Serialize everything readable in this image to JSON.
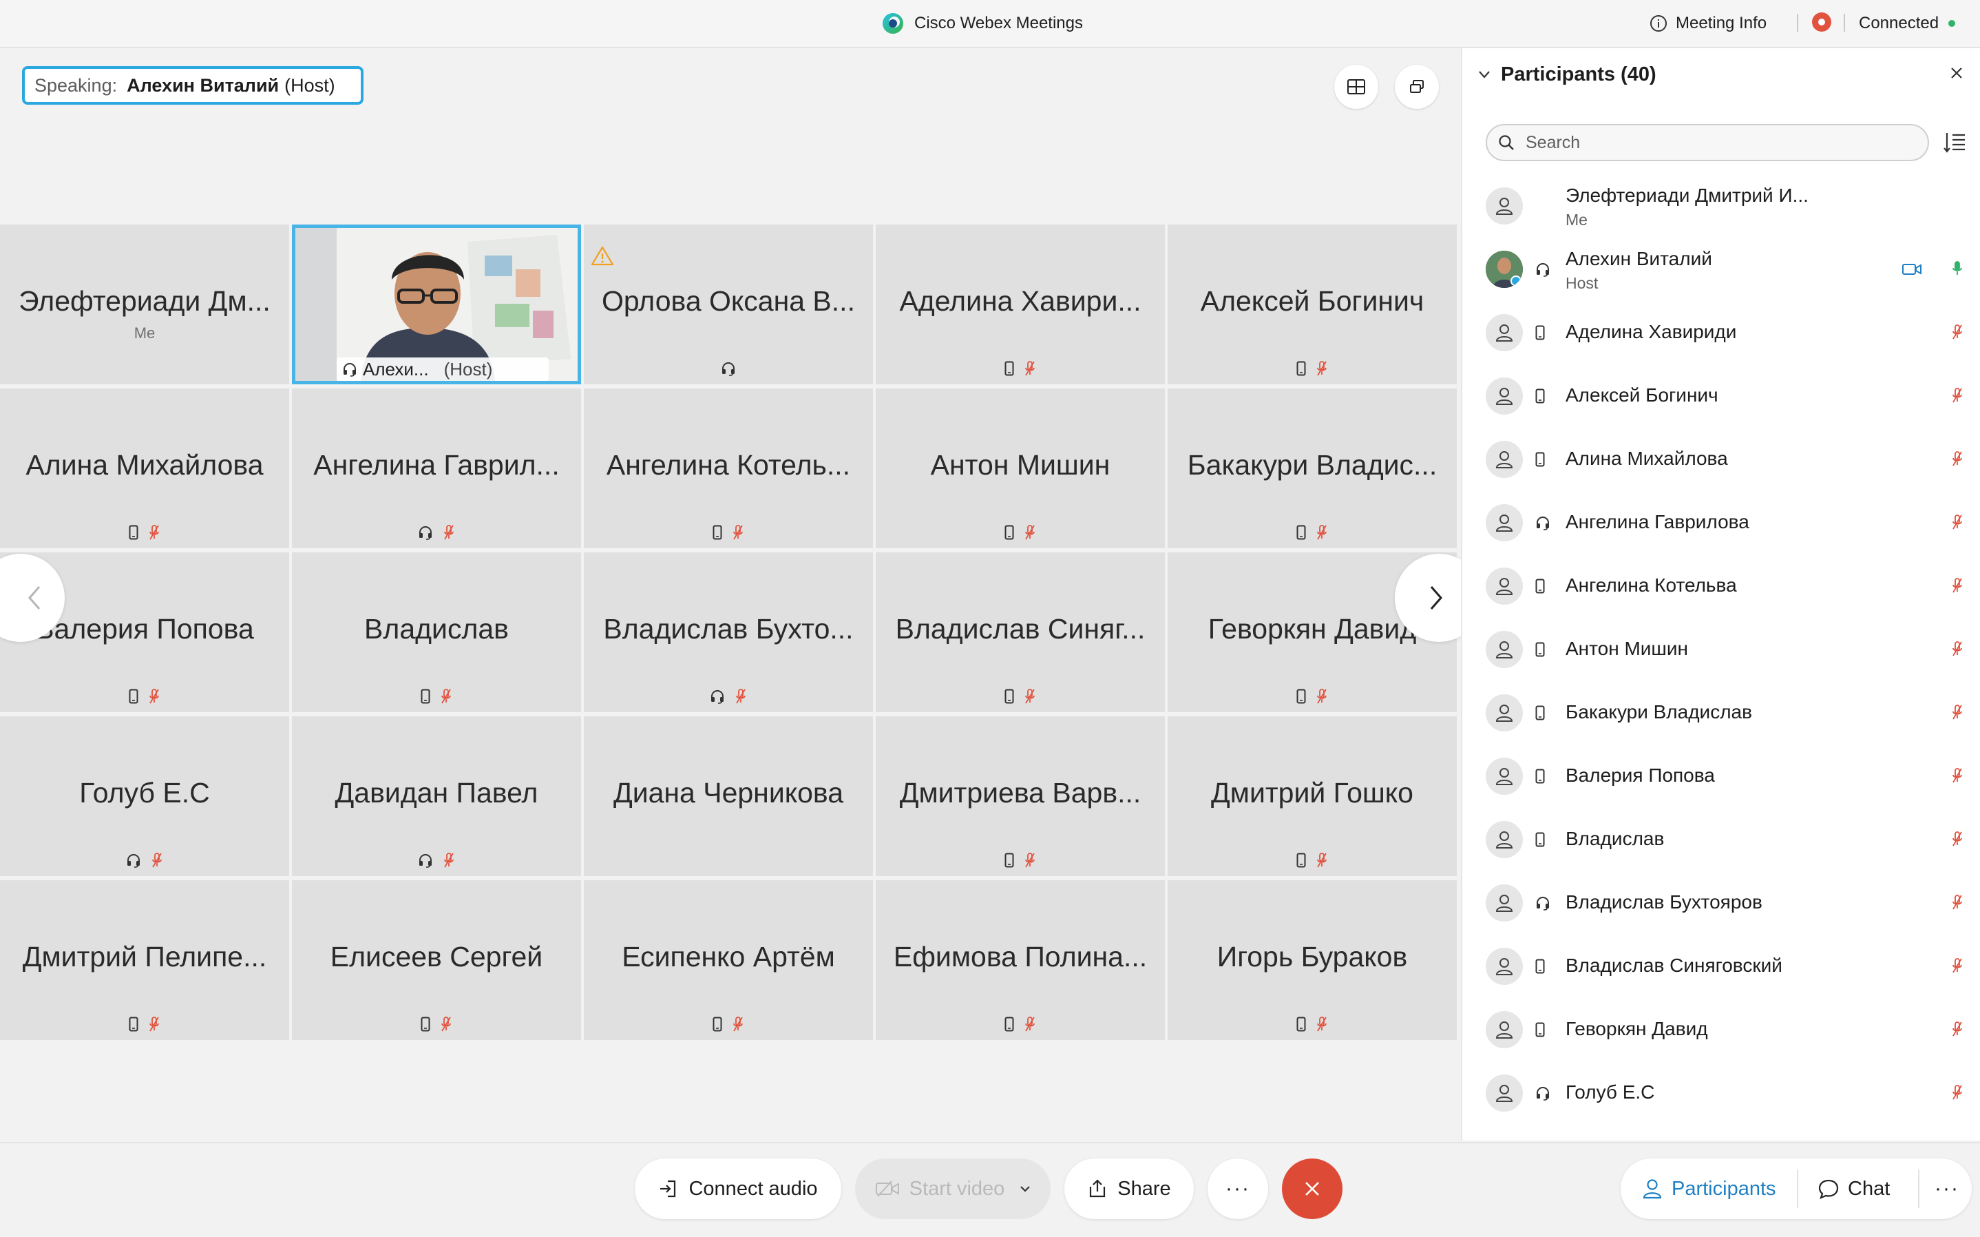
{
  "titlebar": {
    "app_title": "Cisco Webex Meetings",
    "meeting_info": "Meeting Info",
    "connection_status": "Connected"
  },
  "stage": {
    "speaking_label": "Speaking:",
    "speaking_name": "Алехин Виталий",
    "speaking_role": "(Host)",
    "tiles": [
      {
        "name": "Элефтериади Дм...",
        "sub": "Me",
        "icons": []
      },
      {
        "name": "Алехи...",
        "sub": "(Host)",
        "video": true,
        "icons": []
      },
      {
        "name": "Орлова Оксана В...",
        "warn": true,
        "icons": [
          "headset-icon"
        ]
      },
      {
        "name": "Аделина Хавири...",
        "icons": [
          "phone-icon",
          "mic-muted-icon"
        ]
      },
      {
        "name": "Алексей Богинич",
        "icons": [
          "phone-icon",
          "mic-muted-icon"
        ]
      },
      {
        "name": "Алина Михайлова",
        "icons": [
          "phone-icon",
          "mic-muted-icon"
        ]
      },
      {
        "name": "Ангелина Гаврил...",
        "icons": [
          "headset-icon",
          "mic-muted-icon"
        ]
      },
      {
        "name": "Ангелина Котель...",
        "icons": [
          "phone-icon",
          "mic-muted-icon"
        ]
      },
      {
        "name": "Антон Мишин",
        "icons": [
          "phone-icon",
          "mic-muted-icon"
        ]
      },
      {
        "name": "Бакакури Владис...",
        "icons": [
          "phone-icon",
          "mic-muted-icon"
        ]
      },
      {
        "name": "Валерия Попова",
        "icons": [
          "phone-icon",
          "mic-muted-icon"
        ]
      },
      {
        "name": "Владислав",
        "icons": [
          "phone-icon",
          "mic-muted-icon"
        ]
      },
      {
        "name": "Владислав Бухто...",
        "icons": [
          "headset-icon",
          "mic-muted-icon"
        ]
      },
      {
        "name": "Владислав Синяг...",
        "icons": [
          "phone-icon",
          "mic-muted-icon"
        ]
      },
      {
        "name": "Геворкян Давид",
        "icons": [
          "phone-icon",
          "mic-muted-icon"
        ]
      },
      {
        "name": "Голуб Е.С",
        "icons": [
          "headset-icon",
          "mic-muted-icon"
        ]
      },
      {
        "name": "Давидан Павел",
        "icons": [
          "headset-icon",
          "mic-muted-icon"
        ]
      },
      {
        "name": "Диана Черникова",
        "icons": []
      },
      {
        "name": "Дмитриева Варв...",
        "icons": [
          "phone-icon",
          "mic-muted-icon"
        ]
      },
      {
        "name": "Дмитрий Гошко",
        "icons": [
          "phone-icon",
          "mic-muted-icon"
        ]
      },
      {
        "name": "Дмитрий Пелипе...",
        "icons": [
          "phone-icon",
          "mic-muted-icon"
        ]
      },
      {
        "name": "Елисеев Сергей",
        "icons": [
          "phone-icon",
          "mic-muted-icon"
        ]
      },
      {
        "name": "Есипенко Артём",
        "icons": [
          "phone-icon",
          "mic-muted-icon"
        ]
      },
      {
        "name": "Ефимова Полина...",
        "icons": [
          "phone-icon",
          "mic-muted-icon"
        ]
      },
      {
        "name": "Игорь Бураков",
        "icons": [
          "phone-icon",
          "mic-muted-icon"
        ]
      }
    ]
  },
  "panel": {
    "title": "Participants (40)",
    "search_placeholder": "Search",
    "participants": [
      {
        "name": "Элефтериади Дмитрий И...",
        "role": "Me",
        "device": "",
        "mic": ""
      },
      {
        "name": "Алехин Виталий",
        "role": "Host",
        "device": "headset-icon",
        "mic": "mic-active-icon",
        "video": true,
        "photo": true
      },
      {
        "name": "Аделина Хавириди",
        "device": "phone-icon",
        "mic": "mic-muted-icon"
      },
      {
        "name": "Алексей Богинич",
        "device": "phone-icon",
        "mic": "mic-muted-icon"
      },
      {
        "name": "Алина Михайлова",
        "device": "phone-icon",
        "mic": "mic-muted-icon"
      },
      {
        "name": "Ангелина Гаврилова",
        "device": "headset-icon",
        "mic": "mic-muted-icon"
      },
      {
        "name": "Ангелина Котельва",
        "device": "phone-icon",
        "mic": "mic-muted-icon"
      },
      {
        "name": "Антон Мишин",
        "device": "phone-icon",
        "mic": "mic-muted-icon"
      },
      {
        "name": "Бакакури Владислав",
        "device": "phone-icon",
        "mic": "mic-muted-icon"
      },
      {
        "name": "Валерия Попова",
        "device": "phone-icon",
        "mic": "mic-muted-icon"
      },
      {
        "name": "Владислав",
        "device": "phone-icon",
        "mic": "mic-muted-icon"
      },
      {
        "name": "Владислав Бухтояров",
        "device": "headset-icon",
        "mic": "mic-muted-icon"
      },
      {
        "name": "Владислав Синяговский",
        "device": "phone-icon",
        "mic": "mic-muted-icon"
      },
      {
        "name": "Геворкян Давид",
        "device": "phone-icon",
        "mic": "mic-muted-icon"
      },
      {
        "name": "Голуб Е.С",
        "device": "headset-icon",
        "mic": "mic-muted-icon"
      }
    ]
  },
  "bottombar": {
    "connect_audio": "Connect audio",
    "start_video": "Start video",
    "share": "Share",
    "more": "···",
    "participants": "Participants",
    "chat": "Chat"
  },
  "colors": {
    "accent": "#2aa8df",
    "muted_red": "#e2533f",
    "end_red": "#dd4b36",
    "active_green": "#2fb369",
    "participants_blue": "#1e7fc4"
  }
}
